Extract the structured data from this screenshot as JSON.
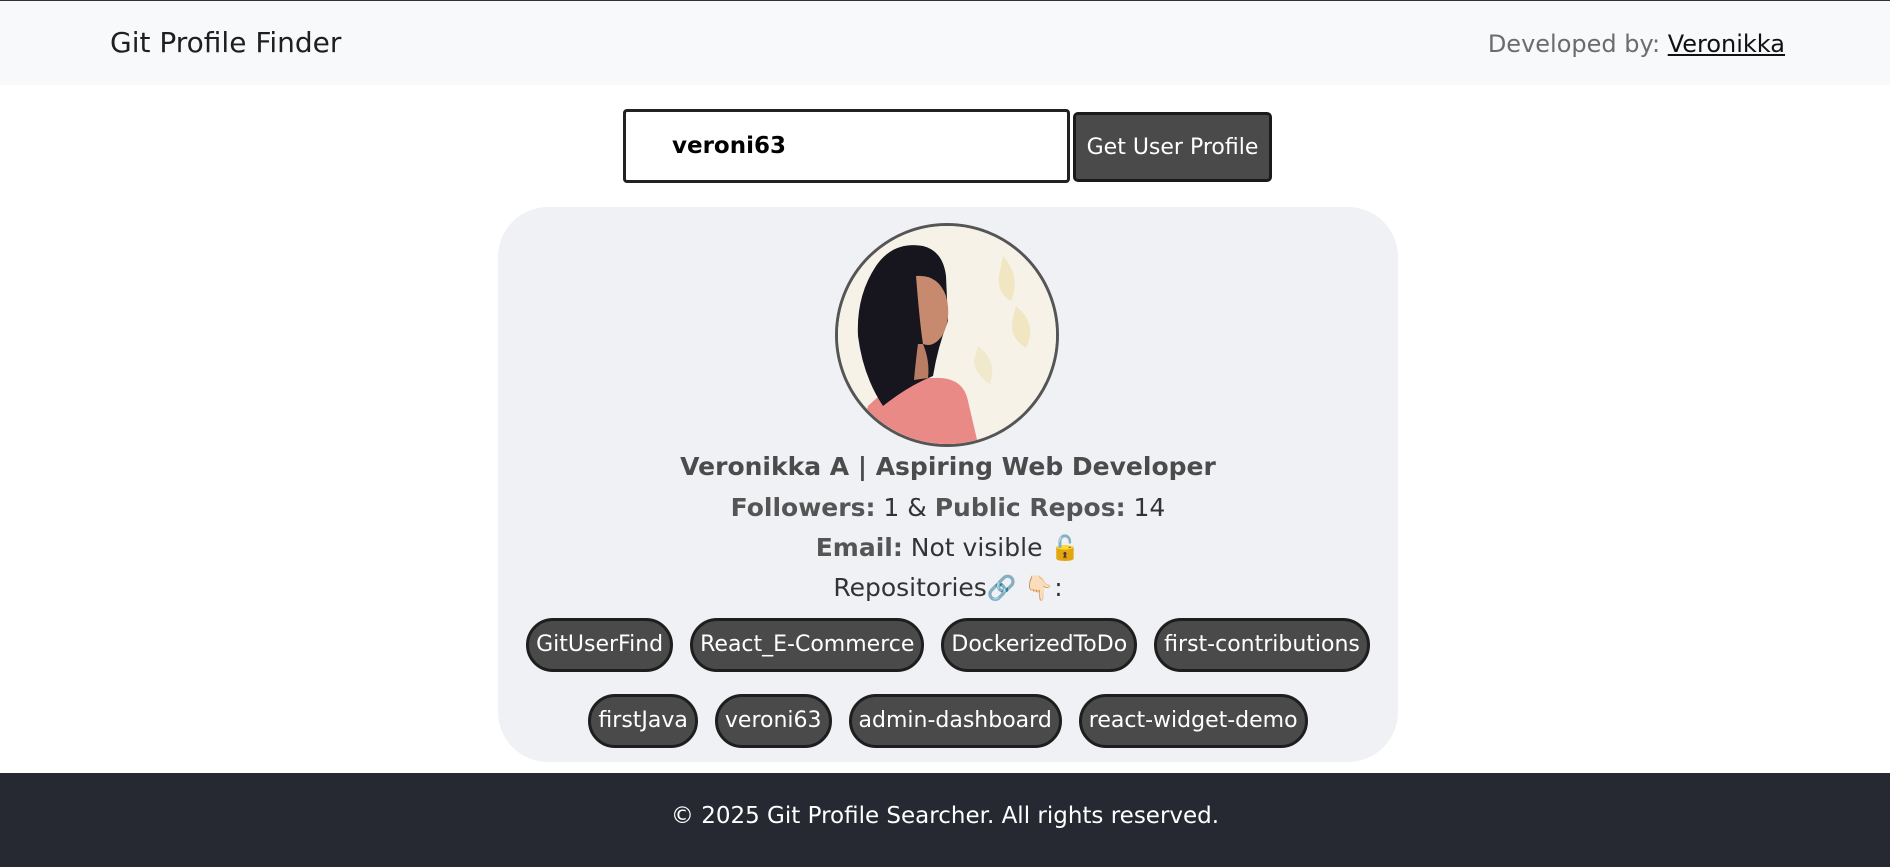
{
  "navbar": {
    "brand": "Git Profile Finder",
    "developed_by_label": "Developed by:",
    "developer_name": "Veronikka"
  },
  "search": {
    "value": "veroni63",
    "button_label": "Get User Profile"
  },
  "profile": {
    "avatar_icon": "profile-photo",
    "name": "Veronikka A | Aspiring Web Developer",
    "followers_label": "Followers:",
    "followers_value": "1",
    "separator": "&",
    "repos_label": "Public Repos:",
    "repos_value": "14",
    "email_label": "Email:",
    "email_value": "Not visible",
    "email_emoji": "🔓",
    "repositories_label": "Repositories",
    "repositories_emoji": "🔗 👇🏻",
    "repositories_suffix": ":",
    "repositories": [
      "GitUserFind",
      "React_E-Commerce",
      "DockerizedToDo",
      "first-contributions",
      "firstJava",
      "veroni63",
      "admin-dashboard",
      "react-widget-demo"
    ]
  },
  "footer": {
    "text": "© 2025 Git Profile Searcher. All rights reserved."
  },
  "colors": {
    "navbar_bg": "#f8f9fa",
    "card_bg": "#f0f1f5",
    "button_bg": "#4a4a4a",
    "footer_bg": "#262932"
  }
}
